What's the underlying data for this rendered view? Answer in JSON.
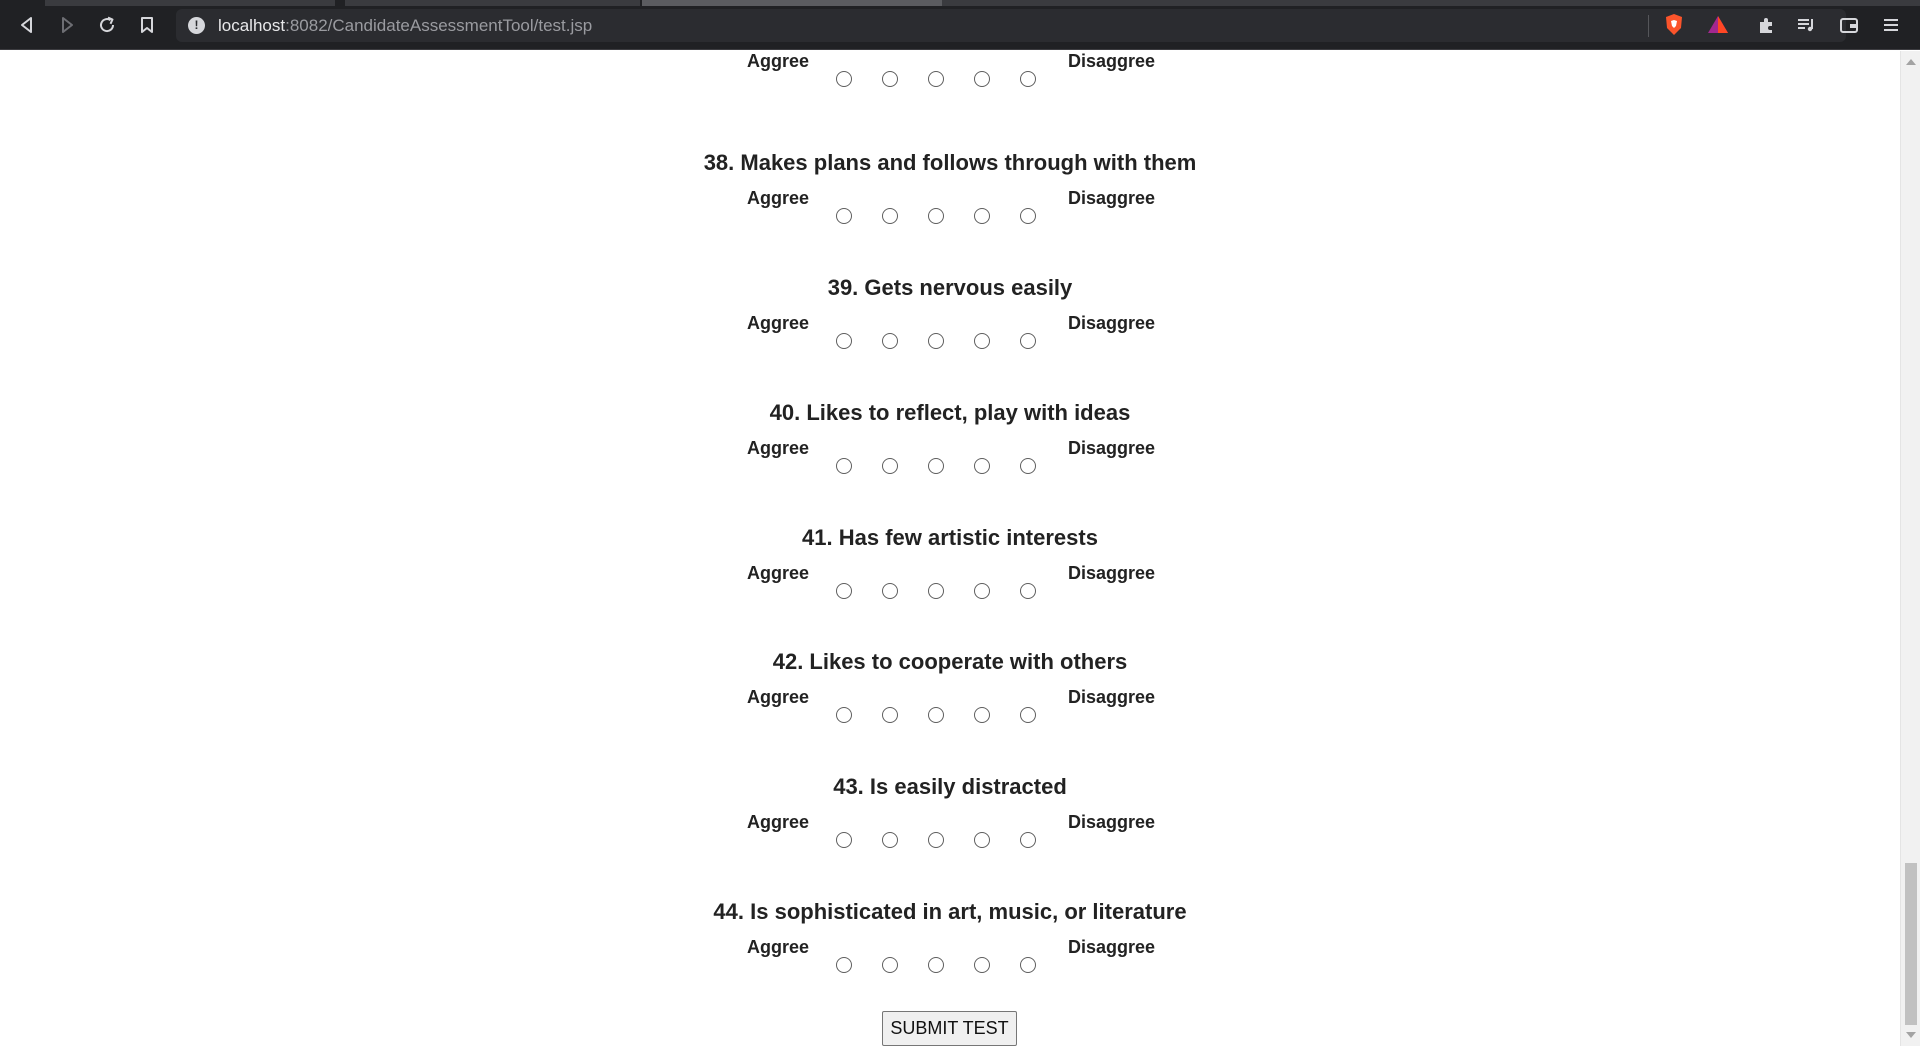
{
  "browser": {
    "url_host": "localhost",
    "url_rest": ":8082/CandidateAssessmentTool/test.jsp",
    "info_glyph": "!"
  },
  "scale": {
    "left_label": "Aggree",
    "right_label": "Disaggree"
  },
  "partial_question": {
    "left_label": "Aggree",
    "right_label": "Disaggree"
  },
  "questions": [
    {
      "label": "38. Makes plans and follows through with them"
    },
    {
      "label": "39. Gets nervous easily"
    },
    {
      "label": "40. Likes to reflect, play with ideas"
    },
    {
      "label": "41. Has few artistic interests"
    },
    {
      "label": "42. Likes to cooperate with others"
    },
    {
      "label": "43. Is easily distracted"
    },
    {
      "label": "44. Is sophisticated in art, music, or literature"
    }
  ],
  "submit": {
    "label": "SUBMIT TEST"
  },
  "icons": {
    "back": "back-icon",
    "forward": "forward-icon",
    "reload": "reload-icon",
    "bookmark": "bookmark-icon",
    "site_info": "info-icon",
    "brave_shield": "brave-shield-icon",
    "brave_rewards": "brave-rewards-icon",
    "extensions": "puzzle-icon",
    "playlist": "playlist-icon",
    "wallet": "wallet-icon",
    "menu": "hamburger-menu-icon"
  },
  "colors": {
    "chrome_bg": "#202124",
    "urlbar_bg": "#2b2c30",
    "brave_orange": "#fb542b",
    "page_bg": "#ffffff",
    "text": "#222222"
  }
}
